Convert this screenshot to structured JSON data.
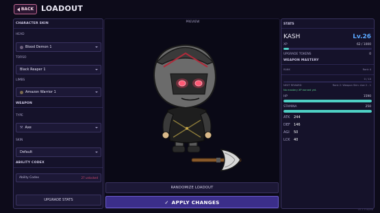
{
  "header": {
    "back_label": "BACK",
    "title": "LOADOUT"
  },
  "left": {
    "character_skin_title": "CHARACTER SKIN",
    "head_label": "HEAD",
    "head_value": "Blood Demon 1",
    "torso_label": "TORSO",
    "torso_value": "Black Reaper 1",
    "limbs_label": "LIMBS",
    "limbs_value": "Amazon Warrior 1",
    "weapon_title": "WEAPON",
    "type_label": "TYPE",
    "type_value": "Axe",
    "skin_label": "SKIN",
    "skin_value": "Default",
    "ability_title": "ABILITY CODEX",
    "ability_row": "Ability Codex",
    "ability_count": "27 unlocked",
    "upgrade_label": "UPGRADE STATS"
  },
  "center": {
    "preview_label": "PREVIEW",
    "randomize_label": "RANDOMIZE LOADOUT",
    "apply_label": "APPLY CHANGES"
  },
  "stats": {
    "title": "STATS",
    "name": "KASH",
    "level": "Lv.26",
    "xp_label": "XP",
    "xp_value": "62 / 1000",
    "xp_fraction": 0.062,
    "tokens_label": "UPGRADE TOKENS",
    "tokens_value": "0",
    "mastery_title": "WEAPON MASTERY",
    "rank_label": "RANK",
    "rank_value": "Rank 4",
    "mastery_progress": "0 / 10",
    "next_reward_label": "NEXT REWARD",
    "next_reward_value": "Rank 2: Weapon Skin: Axe 2 - 1",
    "mastery_note": "No mastery XP earned yet.",
    "hp_label": "HP",
    "hp_value": "1590",
    "hp_fraction": 1.0,
    "stamina_label": "STAMINA",
    "stamina_value": "250",
    "stamina_fraction": 1.0,
    "atk_label": "ATK",
    "atk_value": "244",
    "def_label": "DEF",
    "def_value": "146",
    "agi_label": "AGI",
    "agi_value": "50",
    "lck_label": "LCK",
    "lck_value": "40"
  },
  "version": "v0.1.0 alpha",
  "colors": {
    "accent": "#5aa7ff",
    "hp": "#4fd1c5",
    "xp": "#4fd1c5",
    "apply": "#3b2e8a"
  }
}
